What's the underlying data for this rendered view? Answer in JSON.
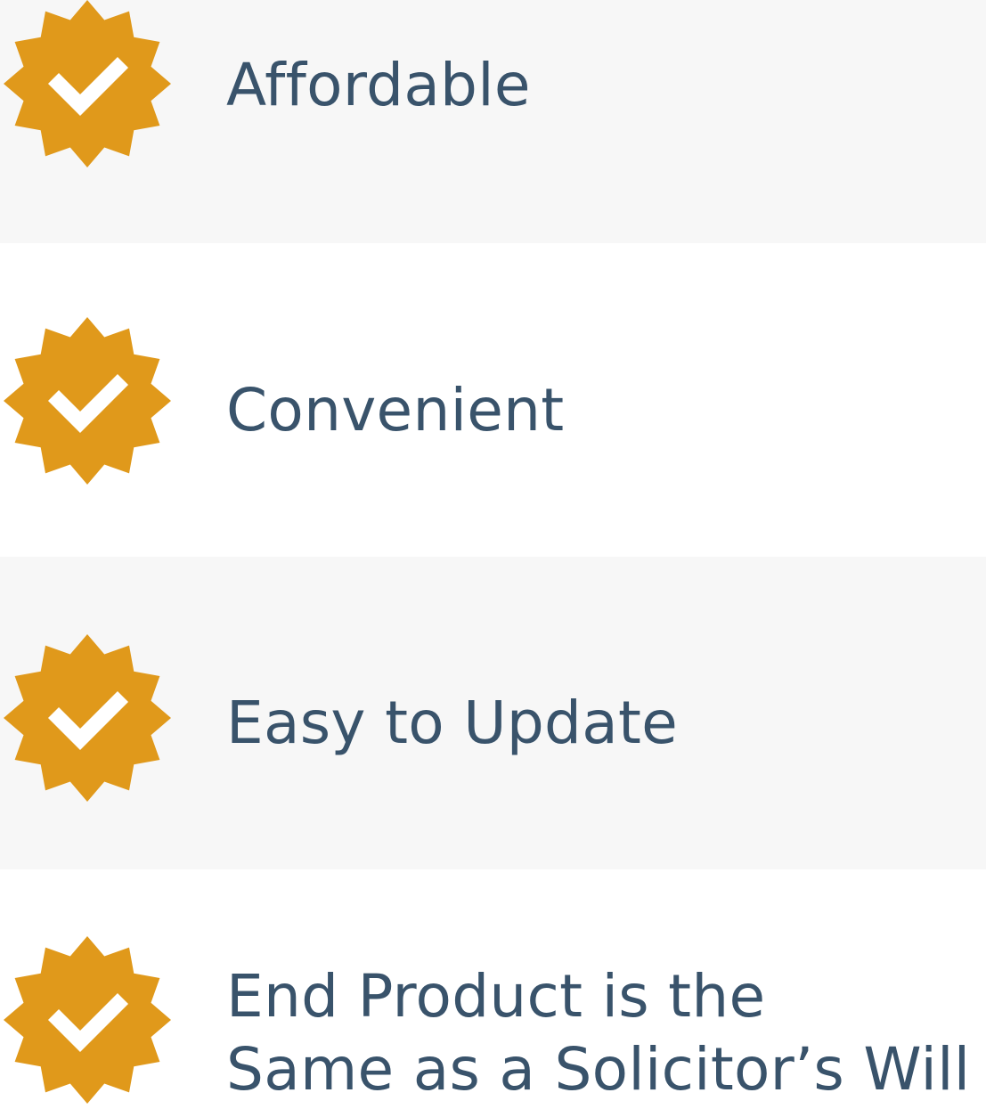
{
  "colors": {
    "badge": "#e0991b",
    "check": "#ffffff",
    "text": "#39536b",
    "shaded_row": "#f7f7f7"
  },
  "features": [
    {
      "label": "Affordable",
      "icon": "check-badge-icon"
    },
    {
      "label": "Convenient",
      "icon": "check-badge-icon"
    },
    {
      "label": "Easy to Update",
      "icon": "check-badge-icon"
    },
    {
      "label": "End Product is the Same as a Solicitor’s Will",
      "line1": "End Product is the",
      "line2": "Same as a Solicitor’s Will",
      "icon": "check-badge-icon"
    }
  ]
}
